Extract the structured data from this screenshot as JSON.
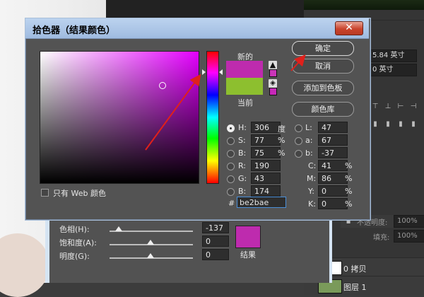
{
  "dialog": {
    "title": "拾色器（结果颜色）",
    "close_glyph": "✕",
    "new_label": "新的",
    "current_label": "当前",
    "new_color": "#be2bae",
    "current_color": "#8dbf2f",
    "warn_swatch_color": "#c935b8",
    "cube_swatch_color": "#c728b9",
    "buttons": {
      "ok": "确定",
      "cancel": "取消",
      "add_swatch": "添加到色板",
      "color_library": "颜色库"
    },
    "only_web_colors": "只有 Web 颜色",
    "fields": {
      "h": {
        "label": "H:",
        "value": "306",
        "unit": "度"
      },
      "s": {
        "label": "S:",
        "value": "77",
        "unit": "%"
      },
      "b": {
        "label": "B:",
        "value": "75",
        "unit": "%"
      },
      "r": {
        "label": "R:",
        "value": "190"
      },
      "g": {
        "label": "G:",
        "value": "43"
      },
      "bl": {
        "label": "B:",
        "value": "174"
      },
      "l": {
        "label": "L:",
        "value": "47"
      },
      "a": {
        "label": "a:",
        "value": "67"
      },
      "lab_b": {
        "label": "b:",
        "value": "-37"
      },
      "c": {
        "label": "C:",
        "value": "41",
        "unit": "%"
      },
      "m": {
        "label": "M:",
        "value": "86",
        "unit": "%"
      },
      "y": {
        "label": "Y:",
        "value": "0",
        "unit": "%"
      },
      "k": {
        "label": "K:",
        "value": "0",
        "unit": "%"
      }
    },
    "hex_hash": "#",
    "hex": "be2bae"
  },
  "adjust_panel": {
    "hue": {
      "label": "色相(H):",
      "value": "-137"
    },
    "saturation": {
      "label": "饱和度(A):",
      "value": "0"
    },
    "lightness": {
      "label": "明度(G):",
      "value": "0"
    },
    "result_label": "结果",
    "result_color": "#be2bae"
  },
  "right_panel": {
    "field1": "5.84 英寸",
    "field2": "0 英寸",
    "opacity_label": "不透明度:",
    "opacity_value": "100%",
    "fill_label": "填充:",
    "fill_value": "100%",
    "layer1": "0 拷贝",
    "layer2": "图层 1"
  }
}
